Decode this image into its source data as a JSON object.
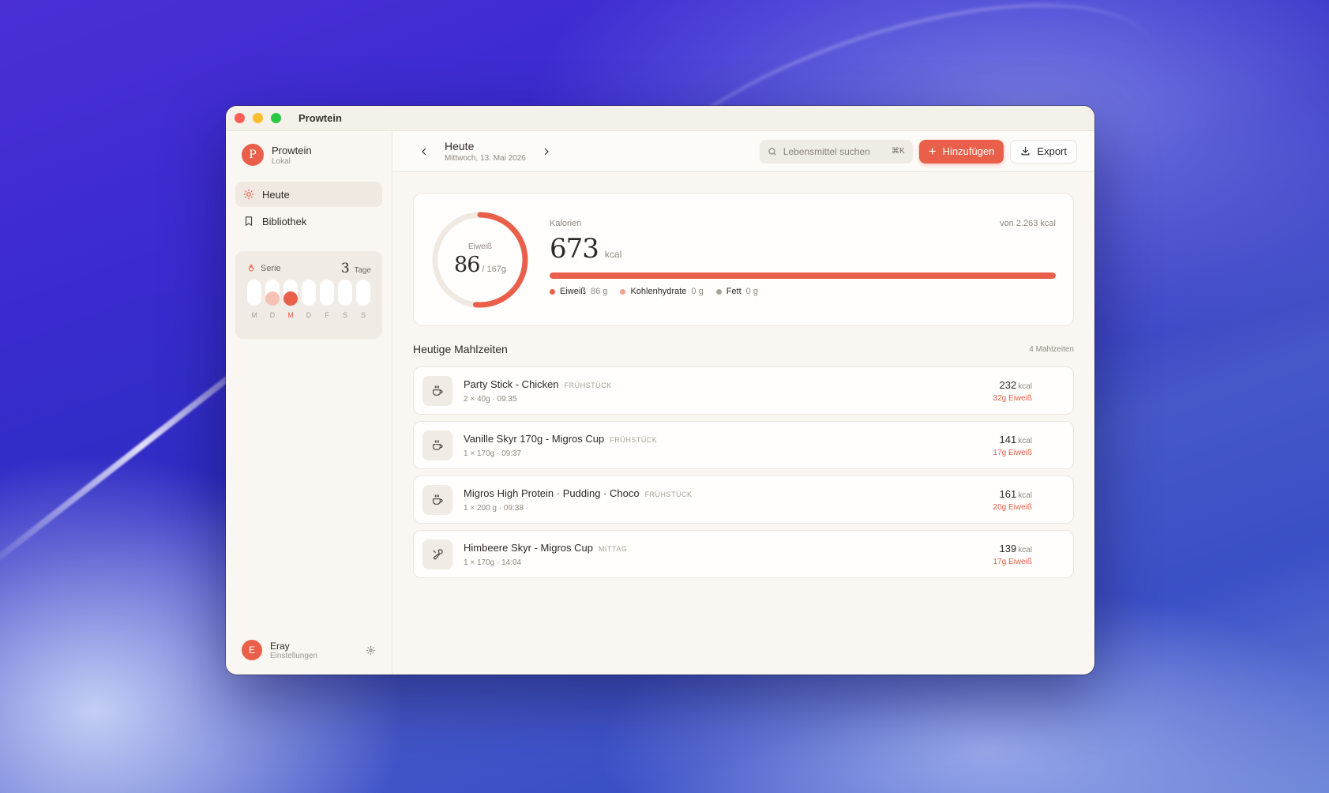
{
  "window": {
    "title": "Prowtein"
  },
  "sidebar": {
    "brand": {
      "name": "Prowtein",
      "subtitle": "Lokal",
      "logo_letter": "P"
    },
    "nav": [
      {
        "label": "Heute",
        "icon": "sun-icon",
        "active": true
      },
      {
        "label": "Bibliothek",
        "icon": "bookmark-icon",
        "active": false
      }
    ],
    "streak": {
      "label": "Serie",
      "count": "3",
      "unit": "Tage",
      "days": [
        {
          "label": "M",
          "state": "none"
        },
        {
          "label": "D",
          "state": "partial"
        },
        {
          "label": "M",
          "state": "today"
        },
        {
          "label": "D",
          "state": "none"
        },
        {
          "label": "F",
          "state": "none"
        },
        {
          "label": "S",
          "state": "none"
        },
        {
          "label": "S",
          "state": "none"
        }
      ]
    },
    "user": {
      "initial": "E",
      "name": "Eray",
      "subtitle": "Einstellungen"
    }
  },
  "topbar": {
    "title": "Heute",
    "date": "Mittwoch, 13. Mai 2026",
    "search_placeholder": "Lebensmittel suchen",
    "search_shortcut": "⌘K",
    "add_label": "Hinzufügen",
    "export_label": "Export"
  },
  "summary": {
    "protein_label": "Eiweiß",
    "protein_value": "86",
    "protein_goal": "/ 167g",
    "protein_fraction": 0.515,
    "calories_label": "Kalorien",
    "calories_goal": "von 2.263 kcal",
    "calories_value": "673",
    "calories_unit": "kcal",
    "calories_bar_fraction": 1.0,
    "macros": [
      {
        "label": "Eiweiß",
        "value": "86 g",
        "color": "#e95f4a"
      },
      {
        "label": "Kohlenhydrate",
        "value": "0 g",
        "color": "#f2a08f"
      },
      {
        "label": "Fett",
        "value": "0 g",
        "color": "#a9a39b"
      }
    ]
  },
  "meals_section": {
    "title": "Heutige Mahlzeiten",
    "count": "4 Mahlzeiten"
  },
  "meals": [
    {
      "name": "Party Stick - Chicken",
      "tag": "FRÜHSTÜCK",
      "detail": "2 × 40g · 09:35",
      "kcal": "232",
      "unit": "kcal",
      "protein": "32g Eiweiß",
      "icon": "coffee-icon"
    },
    {
      "name": "Vanille Skyr 170g - Migros Cup",
      "tag": "FRÜHSTÜCK",
      "detail": "1 × 170g · 09:37",
      "kcal": "141",
      "unit": "kcal",
      "protein": "17g Eiweiß",
      "icon": "coffee-icon"
    },
    {
      "name": "Migros High Protein · Pudding · Choco",
      "tag": "FRÜHSTÜCK",
      "detail": "1 × 200 g · 09:38",
      "kcal": "161",
      "unit": "kcal",
      "protein": "20g Eiweiß",
      "icon": "coffee-icon"
    },
    {
      "name": "Himbeere Skyr - Migros Cup",
      "tag": "MITTAG",
      "detail": "1 × 170g · 14:04",
      "kcal": "139",
      "unit": "kcal",
      "protein": "17g Eiweiß",
      "icon": "utensils-icon"
    }
  ]
}
